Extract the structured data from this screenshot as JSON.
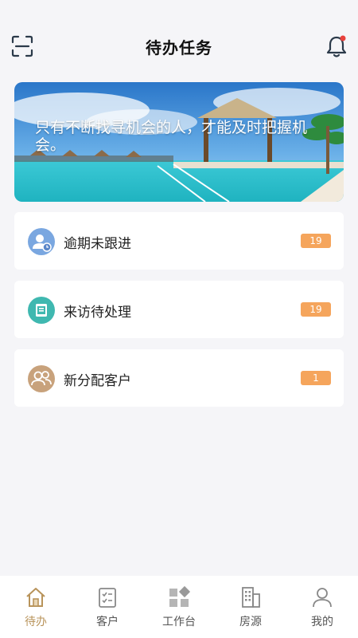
{
  "header": {
    "title": "待办任务",
    "scan_icon": "scan-icon",
    "bell_icon": "bell-icon",
    "notification_dot_color": "#e8413c"
  },
  "banner": {
    "text": "只有不断找寻机会的人，才能及时把握机会。"
  },
  "tasks": [
    {
      "label": "逾期未跟进",
      "count": "19",
      "icon": "overdue-user-icon",
      "icon_color": "#7aa7e0"
    },
    {
      "label": "来访待处理",
      "count": "19",
      "icon": "visit-book-icon",
      "icon_color": "#3fb8b0"
    },
    {
      "label": "新分配客户",
      "count": "1",
      "icon": "new-customers-icon",
      "icon_color": "#c8a27c"
    }
  ],
  "badge_color": "#f5a55c",
  "accent_color": "#b8935a",
  "tabbar": {
    "items": [
      {
        "label": "待办",
        "icon": "home-icon",
        "active": true
      },
      {
        "label": "客户",
        "icon": "checklist-icon",
        "active": false
      },
      {
        "label": "工作台",
        "icon": "workbench-icon",
        "active": false
      },
      {
        "label": "房源",
        "icon": "building-icon",
        "active": false
      },
      {
        "label": "我的",
        "icon": "profile-icon",
        "active": false
      }
    ]
  }
}
